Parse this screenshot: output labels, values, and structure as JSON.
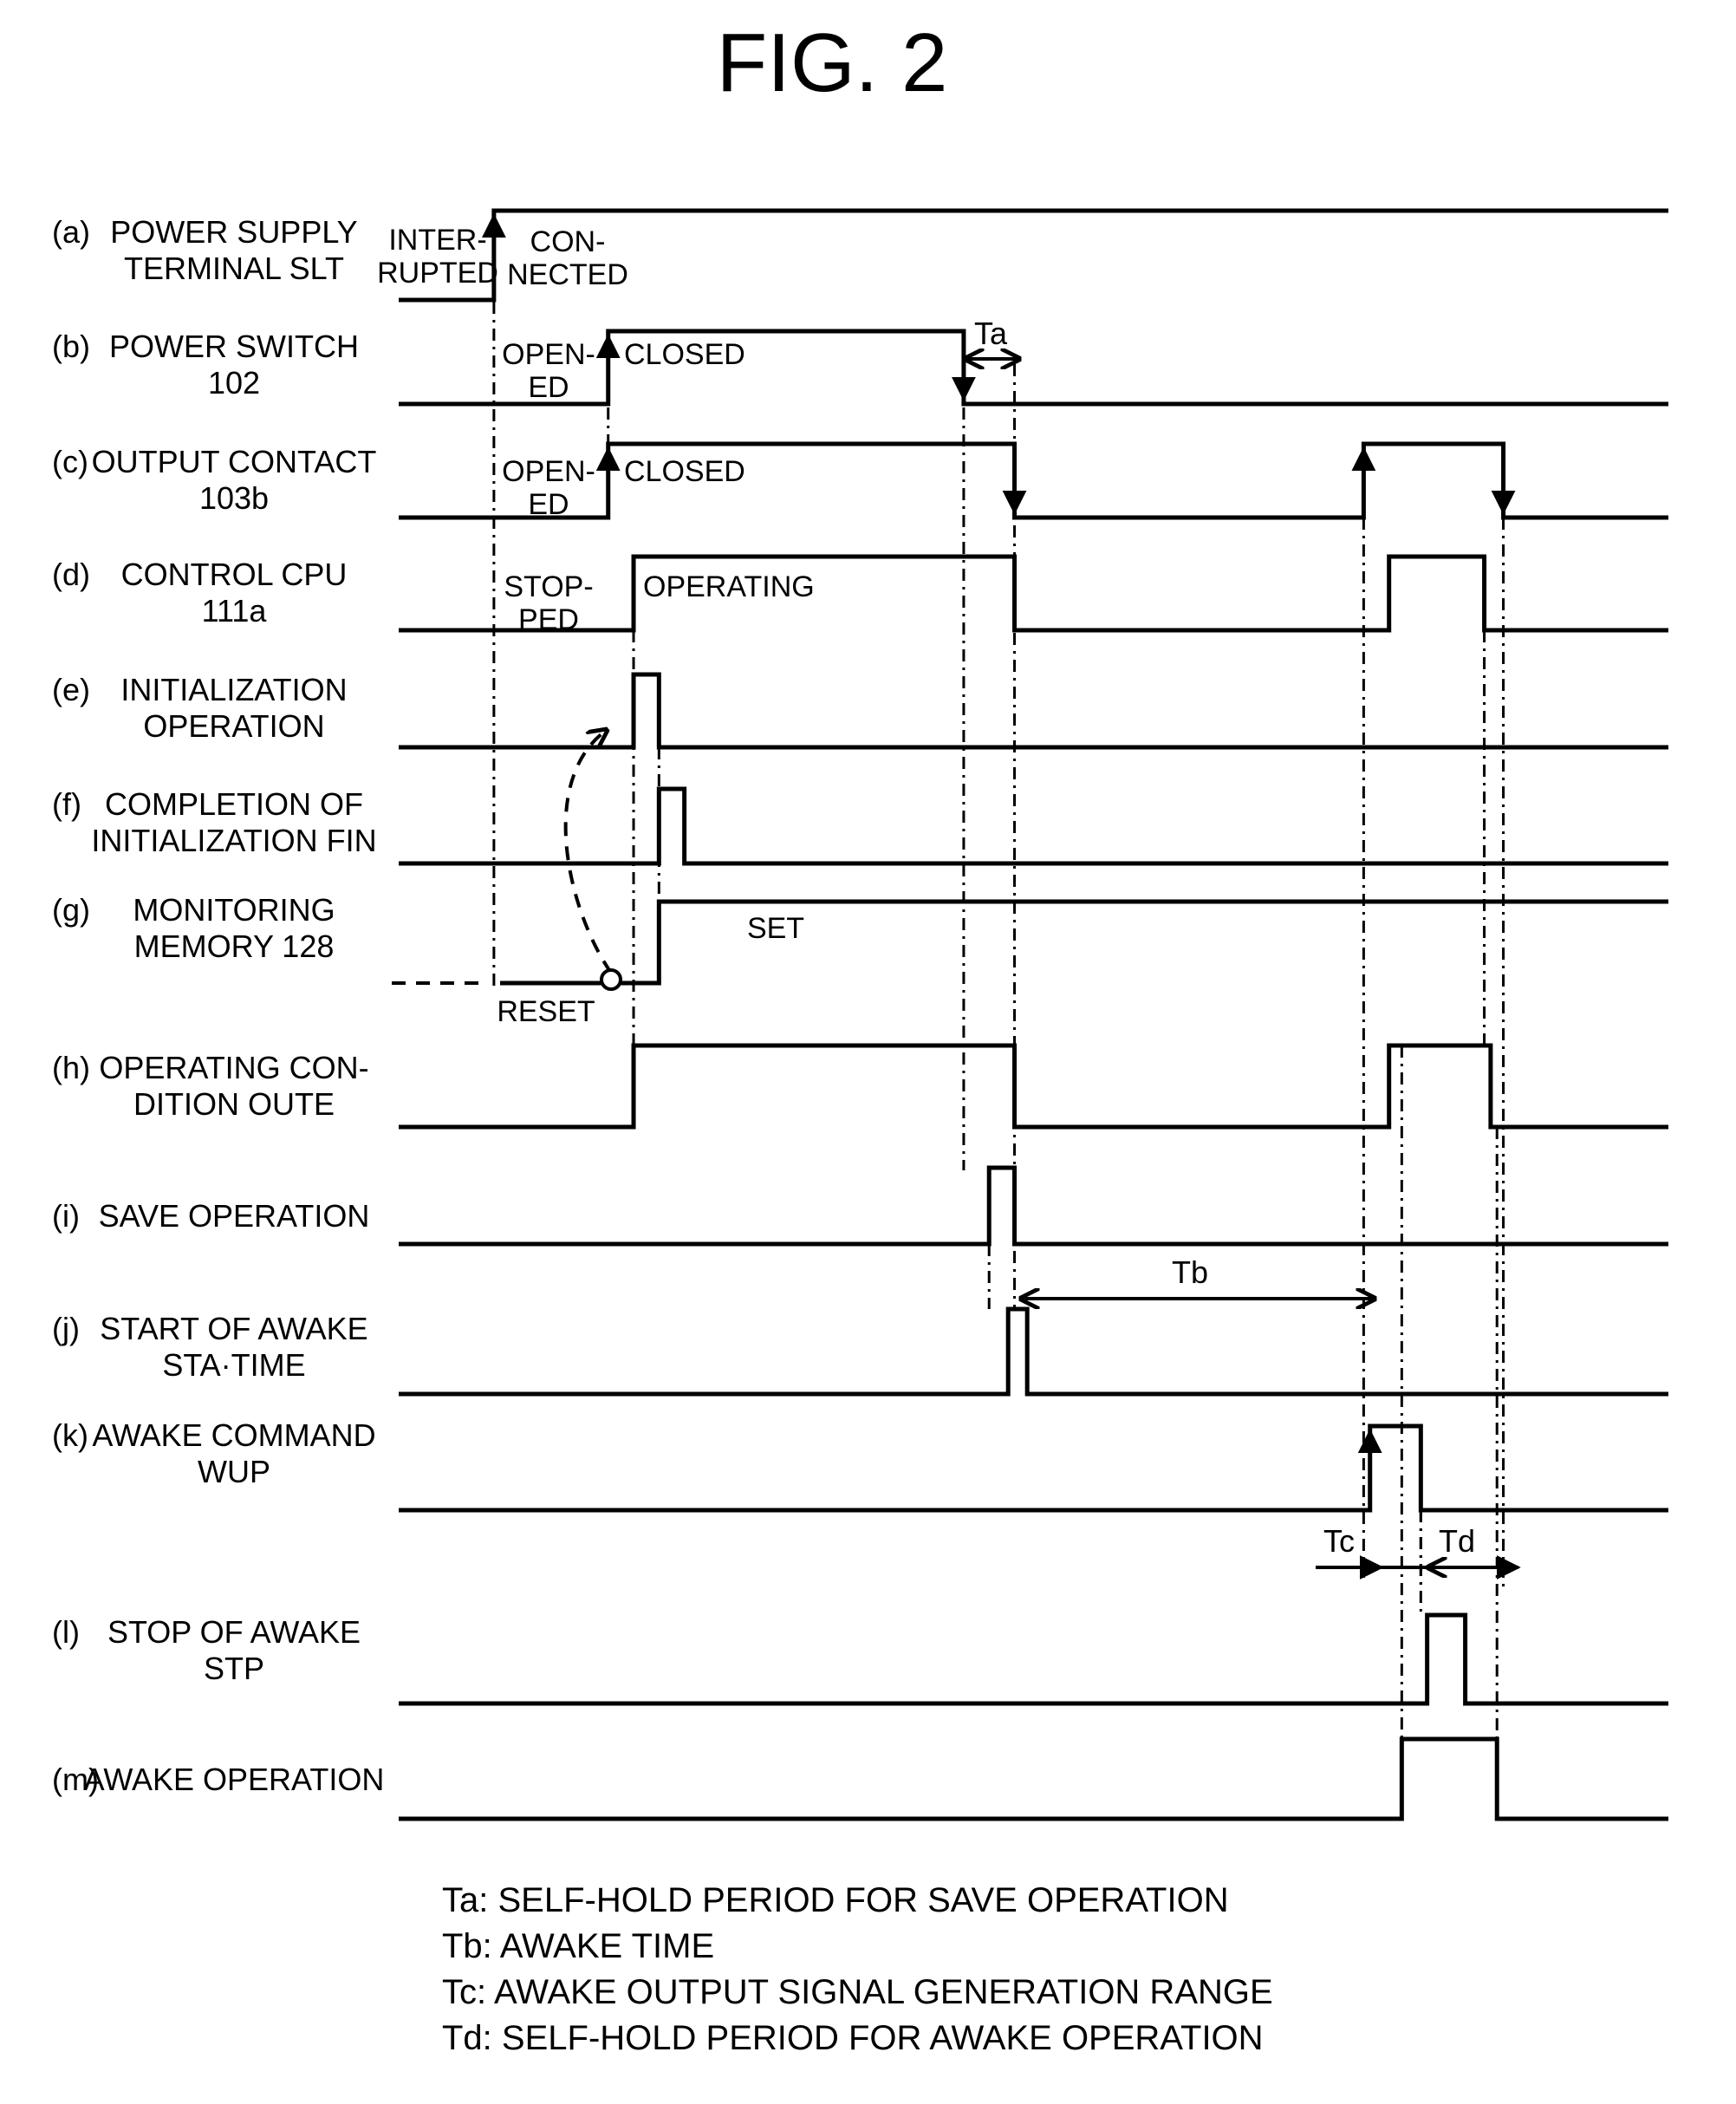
{
  "title": "FIG. 2",
  "signals": [
    {
      "id": "a",
      "tag": "(a)",
      "name_lines": [
        "POWER SUPPLY",
        "TERMINAL SLT"
      ],
      "states": [
        "INTER-\nRUPTED",
        "CON-\nNECTED"
      ]
    },
    {
      "id": "b",
      "tag": "(b)",
      "name_lines": [
        "POWER SWITCH",
        "102"
      ],
      "states": [
        "OPEN-\nED",
        "CLOSED"
      ]
    },
    {
      "id": "c",
      "tag": "(c)",
      "name_lines": [
        "OUTPUT CONTACT",
        "103b"
      ],
      "states": [
        "OPEN-\nED",
        "CLOSED"
      ]
    },
    {
      "id": "d",
      "tag": "(d)",
      "name_lines": [
        "CONTROL CPU",
        "111a"
      ],
      "states": [
        "STOP-\nPED",
        "OPERATING"
      ]
    },
    {
      "id": "e",
      "tag": "(e)",
      "name_lines": [
        "INITIALIZATION",
        "OPERATION"
      ],
      "states": []
    },
    {
      "id": "f",
      "tag": "(f)",
      "name_lines": [
        "COMPLETION OF",
        "INITIALIZATION FIN"
      ],
      "states": []
    },
    {
      "id": "g",
      "tag": "(g)",
      "name_lines": [
        "MONITORING",
        "MEMORY 128"
      ],
      "states": [
        "RESET",
        "SET"
      ]
    },
    {
      "id": "h",
      "tag": "(h)",
      "name_lines": [
        "OPERATING CON-",
        "DITION OUTE"
      ],
      "states": []
    },
    {
      "id": "i",
      "tag": "(i)",
      "name_lines": [
        "SAVE OPERATION"
      ],
      "states": []
    },
    {
      "id": "j",
      "tag": "(j)",
      "name_lines": [
        "START OF AWAKE",
        "STA·TIME"
      ],
      "states": []
    },
    {
      "id": "k",
      "tag": "(k)",
      "name_lines": [
        "AWAKE COMMAND",
        "WUP"
      ],
      "states": []
    },
    {
      "id": "l",
      "tag": "(l)",
      "name_lines": [
        "STOP OF AWAKE",
        "STP"
      ],
      "states": []
    },
    {
      "id": "m",
      "tag": "(m)",
      "name_lines": [
        "AWAKE OPERATION"
      ],
      "states": []
    }
  ],
  "timing": {
    "time_axis_note": "relative time units, 0 = left edge of waveforms, 100 = right edge",
    "events": {
      "power_connected": 7.5,
      "switch_closed": 16.5,
      "cpu_start": 18.5,
      "init_end": 20.5,
      "fin_end": 22.5,
      "switch_opened": 44.5,
      "save_end": 46.5,
      "contact_opened": 48.5,
      "sta_time_end": 48.5,
      "wup_start": 76.5,
      "contact_reclosed": 76,
      "cpu_restart": 78,
      "awake_start": 79,
      "stp_start": 80.5,
      "wup_end": 80.5,
      "stp_end": 83,
      "cpu_stop2": 85.5,
      "awake_end": 86.5,
      "contact_opened2": 87,
      "oute_end": 86
    },
    "waveforms": {
      "a": [
        [
          0,
          0
        ],
        [
          7.5,
          1
        ]
      ],
      "b": [
        [
          0,
          0
        ],
        [
          16.5,
          1
        ],
        [
          44.5,
          0
        ]
      ],
      "c": [
        [
          0,
          0
        ],
        [
          16.5,
          1
        ],
        [
          48.5,
          0
        ],
        [
          76,
          1
        ],
        [
          87,
          0
        ]
      ],
      "d": [
        [
          0,
          0
        ],
        [
          18.5,
          1
        ],
        [
          48.5,
          0
        ],
        [
          78,
          1
        ],
        [
          85.5,
          0
        ]
      ],
      "e": [
        [
          0,
          0
        ],
        [
          18.5,
          1
        ],
        [
          20.5,
          0
        ]
      ],
      "f": [
        [
          0,
          0
        ],
        [
          20.5,
          1
        ],
        [
          22.5,
          0
        ]
      ],
      "g": [
        [
          0,
          0
        ],
        [
          20.5,
          1
        ]
      ],
      "h": [
        [
          0,
          0
        ],
        [
          18.5,
          1
        ],
        [
          48.5,
          0
        ],
        [
          78,
          1
        ],
        [
          86,
          0
        ]
      ],
      "i": [
        [
          0,
          0
        ],
        [
          46.5,
          1
        ],
        [
          48.5,
          0
        ]
      ],
      "j": [
        [
          0,
          0
        ],
        [
          48,
          1
        ],
        [
          49.5,
          0
        ]
      ],
      "k": [
        [
          0,
          0
        ],
        [
          76.5,
          1
        ],
        [
          80.5,
          0
        ]
      ],
      "l": [
        [
          0,
          0
        ],
        [
          81,
          1
        ],
        [
          84,
          0
        ]
      ],
      "m": [
        [
          0,
          0
        ],
        [
          79,
          1
        ],
        [
          86.5,
          0
        ]
      ]
    }
  },
  "intervals": [
    {
      "id": "Ta",
      "label": "Ta"
    },
    {
      "id": "Tb",
      "label": "Tb"
    },
    {
      "id": "Tc",
      "label": "Tc"
    },
    {
      "id": "Td",
      "label": "Td"
    }
  ],
  "legend": [
    "Ta: SELF-HOLD PERIOD FOR SAVE OPERATION",
    "Tb: AWAKE TIME",
    "Tc: AWAKE OUTPUT SIGNAL GENERATION RANGE",
    "Td: SELF-HOLD PERIOD FOR AWAKE OPERATION"
  ]
}
